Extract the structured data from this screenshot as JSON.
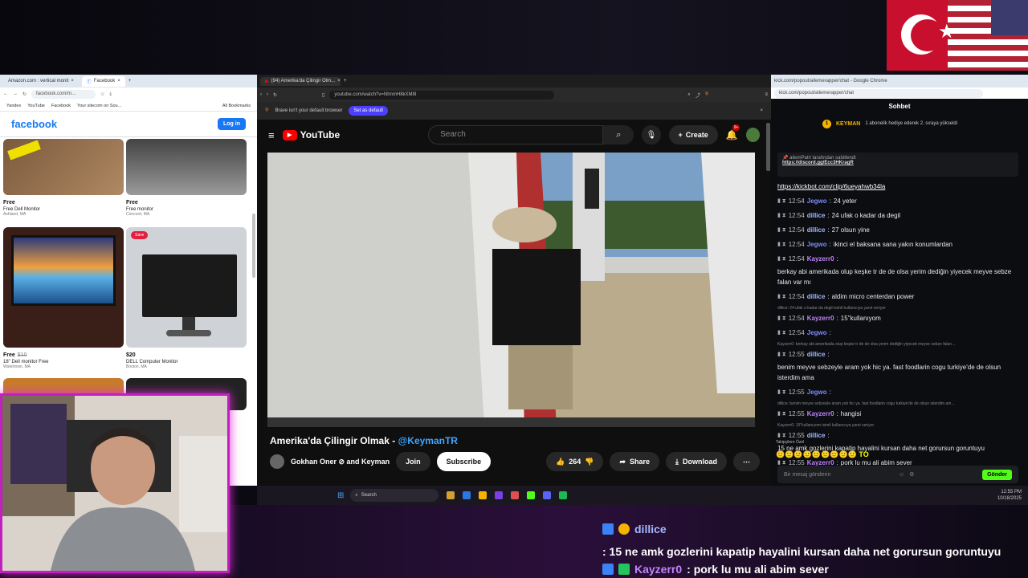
{
  "facebook": {
    "tabs": [
      "Amazon.com : vertical monit",
      "Facebook"
    ],
    "url": "facebook.com/m...",
    "bookmarks": [
      "Yandex",
      "YouTube",
      "Facebook",
      "Your sitecom on Sou...",
      "All Bookmarks"
    ],
    "logo": "facebook",
    "login": "Log in",
    "items": [
      {
        "price": "Free",
        "old": "",
        "title": "Free Dell Monitor",
        "location": "Ashland, MA"
      },
      {
        "price": "Free",
        "old": "",
        "title": "Free monitor",
        "location": "Concord, MA"
      },
      {
        "price": "Free",
        "old": "$10",
        "title": "18\" Dell monitor Free",
        "location": "Watertown, MA"
      },
      {
        "price": "$20",
        "old": "",
        "title": "DELL Computer Monitor",
        "location": "Boston, MA"
      }
    ],
    "save_badge": "Save"
  },
  "youtube": {
    "tab": "(94) Amerika'da Çilingir Olm...",
    "url": "youtube.com/watch?v=NhnmH8kXM8I",
    "brave_notice": "Brave isn't your default browser",
    "set_default": "Set as default",
    "logo": "YouTube",
    "search_placeholder": "Search",
    "create": "Create",
    "notif_count": "9+",
    "title": "Amerika'da Çilingir Olmak - ",
    "title_tag": "@KeymanTR",
    "channel": "Gokhan Oner ⊘ and Keyman",
    "join": "Join",
    "subscribe": "Subscribe",
    "likes": "264",
    "share": "Share",
    "download": "Download"
  },
  "kick": {
    "url": "kick.com/popout/ailemerapper/chat",
    "url_title": "kick.com/popout/ailemerapper/chat - Google Chrome",
    "header": "Sohbet",
    "promo_user": "KEYMAN",
    "promo_text": "1 abonelik hediye ederek 2. sıraya yükseldi",
    "pinned_by": "ailemPatri tarafından sabitlendi",
    "pinned_link": "https://discord.gg/Ecc3HKragR",
    "messages": [
      {
        "type": "link",
        "text": "https://kickbot.com/clip/6ueyahwb34la"
      },
      {
        "time": "12:54",
        "user": "Jegwo",
        "cls": "u-jegwo",
        "text": "24 yeter"
      },
      {
        "time": "12:54",
        "user": "dillice",
        "cls": "u-dillice",
        "text": "24 ufak o kadar da degil"
      },
      {
        "time": "12:54",
        "user": "dillice",
        "cls": "u-dillice",
        "text": "27 olsun yine"
      },
      {
        "time": "12:54",
        "user": "Jegwo",
        "cls": "u-jegwo",
        "text": "ikinci el baksana sana yakın konumlardan"
      },
      {
        "time": "12:54",
        "user": "Kayzerr0",
        "cls": "u-kayz",
        "text": "berkay abi amerikada olup keşke tr de de olsa yerim dediğin yiyecek meyve sebze falan var mı"
      },
      {
        "time": "12:54",
        "user": "dillice",
        "cls": "u-dillice",
        "text": "aldim micro centerdan power"
      },
      {
        "reply": "dillice: 24 ufak o kadar da degil isimli kullanıcıya yanıt veriyor",
        "time": "12:54",
        "user": "Kayzerr0",
        "cls": "u-kayz",
        "text": "15\"kullanıyom"
      },
      {
        "time": "12:54",
        "user": "Jegwo",
        "cls": "u-jegwo",
        "text": ""
      },
      {
        "reply": "Kayzerr0: berkay abi amerikada olup keşke tr de de olsa yerim dediğin yiyecek meyve sebze falan...",
        "time": "12:55",
        "user": "dillice",
        "cls": "u-dillice",
        "text": "benim meyve sebzeyle aram yok hic ya. fast foodlarin cogu turkiye'de de olsun isterdim ama"
      },
      {
        "time": "12:55",
        "user": "Jegwo",
        "cls": "u-jegwo",
        "text": ""
      },
      {
        "reply": "dillice: benim meyve sebzeyle aram yok hic ya. fast foodlarin cogu turkiye'de de olsun isterdim am...",
        "time": "12:55",
        "user": "Kayzerr0",
        "cls": "u-kayz",
        "text": "hangisi"
      },
      {
        "reply": "Kayzerr0: 15\"kullanıyom isimli kullanıcıya yanıt veriyor",
        "time": "12:55",
        "user": "dillice",
        "cls": "u-dillice",
        "text": "15 ne amk gozlerini kapatip hayalini kursan daha net gorursun goruntuyu"
      },
      {
        "time": "12:55",
        "user": "Kayzerr0",
        "cls": "u-kayz",
        "text": "pork lu mu ali abim sever"
      }
    ],
    "followers_only": "Takipçilere Özel",
    "emote_text": "TO",
    "input_placeholder": "Bir mesaj gönderin",
    "send": "Gönder"
  },
  "taskbar": {
    "search": "Search",
    "time": "12:55 PM",
    "date": "10/18/2025"
  },
  "overlay_chat": [
    {
      "user": "dillice",
      "text": ": 15 ne amk gozlerini kapatip hayalini kursan daha net gorursun goruntuyu"
    },
    {
      "user": "Kayzerr0",
      "text": ": pork lu mu ali abim sever"
    }
  ],
  "colors": {
    "kick_green": "#53fc18",
    "youtube_red": "#ff0000",
    "facebook_blue": "#1877f2",
    "cam_border": "#c11fbf"
  }
}
